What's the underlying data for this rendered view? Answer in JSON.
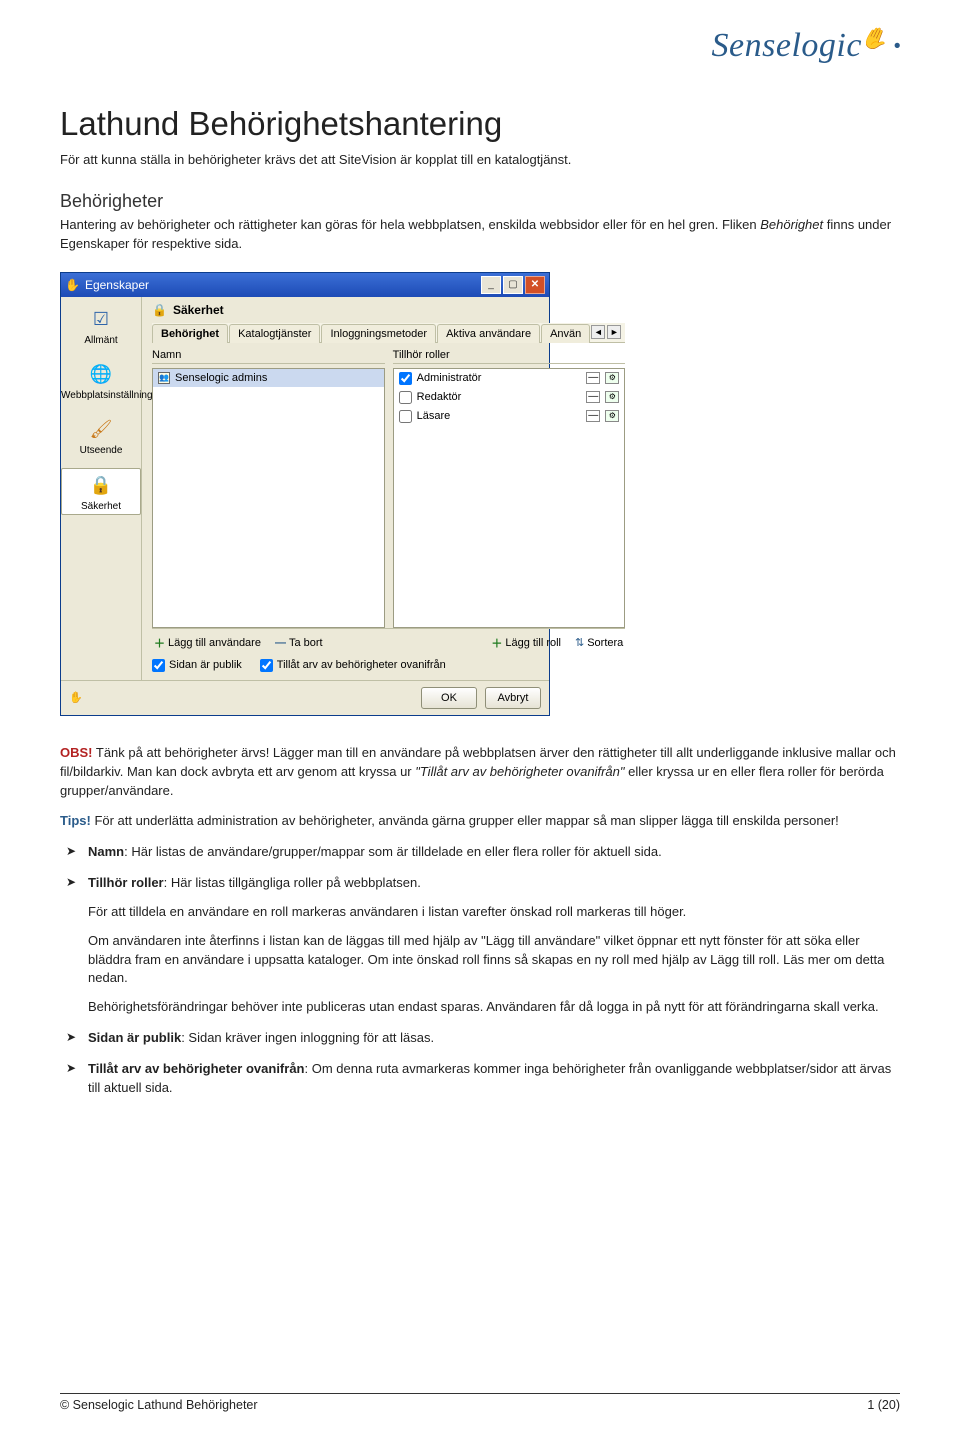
{
  "brand": {
    "name": "Senselogic"
  },
  "title": "Lathund Behörighetshantering",
  "intro1": "För att kunna ställa in behörigheter krävs det att SiteVision är kopplat till en katalogtjänst.",
  "h2": "Behörigheter",
  "intro2_a": "Hantering av behörigheter och rättigheter kan göras för hela webbplatsen, enskilda webbsidor eller för en hel gren. Fliken ",
  "intro2_em": "Behörighet",
  "intro2_b": " finns under Egenskaper för respektive sida.",
  "dialog": {
    "title": "Egenskaper",
    "winbtns": {
      "min": "_",
      "max": "▢",
      "close": "✕"
    },
    "sidebar": [
      {
        "label": "Allmänt",
        "icon": "☑",
        "iconColor": "#2e64a9"
      },
      {
        "label": "Webbplatsinställningar",
        "icon": "🌐",
        "iconColor": "#2e64a9"
      },
      {
        "label": "Utseende",
        "icon": "🖌",
        "iconColor": "#c97a1b"
      },
      {
        "label": "Säkerhet",
        "icon": "🔒",
        "iconColor": "#c9a21b",
        "selected": true
      }
    ],
    "section_icon": "🔒",
    "section_title": "Säkerhet",
    "tabs": [
      "Behörighet",
      "Katalogtjänster",
      "Inloggningsmetoder",
      "Aktiva användare",
      "Använ"
    ],
    "activeTab": 0,
    "col_name": "Namn",
    "col_roles": "Tillhör roller",
    "name_list": [
      {
        "label": "Senselogic admins",
        "selected": true
      }
    ],
    "roles": [
      {
        "label": "Administratör",
        "checked": true
      },
      {
        "label": "Redaktör",
        "checked": false
      },
      {
        "label": "Läsare",
        "checked": false
      }
    ],
    "toolbar": {
      "add_user": "Lägg till användare",
      "remove": "Ta bort",
      "add_role": "Lägg till roll",
      "sort": "Sortera"
    },
    "flag_public": "Sidan är publik",
    "flag_inherit": "Tillåt arv av behörigheter ovanifrån",
    "ok": "OK",
    "cancel": "Avbryt"
  },
  "obs": {
    "label": "OBS!",
    "txt1": " Tänk på att behörigheter ärvs! Lägger man till en användare på webbplatsen ärver den rättigheter till allt underliggande inklusive mallar och fil/bildarkiv. Man kan dock avbryta ett arv genom att kryssa ur ",
    "em1": "\"Tillåt arv av behörigheter ovanifrån\"",
    "txt2": " eller kryssa ur en eller flera roller för berörda grupper/användare."
  },
  "tips": {
    "label": "Tips!",
    "txt": " För att underlätta administration av behörigheter, använda gärna grupper eller mappar så man slipper lägga till enskilda personer!"
  },
  "bullets": [
    {
      "lead": "Namn",
      "txt": ": Här listas de användare/grupper/mappar som är tilldelade en eller flera roller för aktuell sida."
    },
    {
      "lead": "Tillhör roller",
      "txt": ": Här listas tillgängliga roller på webbplatsen.",
      "subs": [
        "För att tilldela en användare en roll markeras användaren i listan varefter önskad roll markeras till höger.",
        "Om användaren inte återfinns i listan kan de läggas till med hjälp av \"Lägg till användare\" vilket öppnar ett nytt fönster för att söka eller bläddra fram en användare i uppsatta kataloger. Om inte önskad roll finns så skapas en ny roll med hjälp av Lägg till roll. Läs mer om detta nedan.",
        "Behörighetsförändringar behöver inte publiceras utan endast sparas. Användaren får då logga in på nytt för att förändringarna skall verka."
      ]
    },
    {
      "lead": "Sidan är publik",
      "txt": ": Sidan kräver ingen inloggning för att läsas."
    },
    {
      "lead": "Tillåt arv av behörigheter ovanifrån",
      "txt": ": Om denna ruta avmarkeras kommer inga behörigheter från ovanliggande webbplatser/sidor att ärvas till aktuell sida."
    }
  ],
  "footer": {
    "left": "© Senselogic Lathund Behörigheter",
    "right": "1 (20)"
  }
}
